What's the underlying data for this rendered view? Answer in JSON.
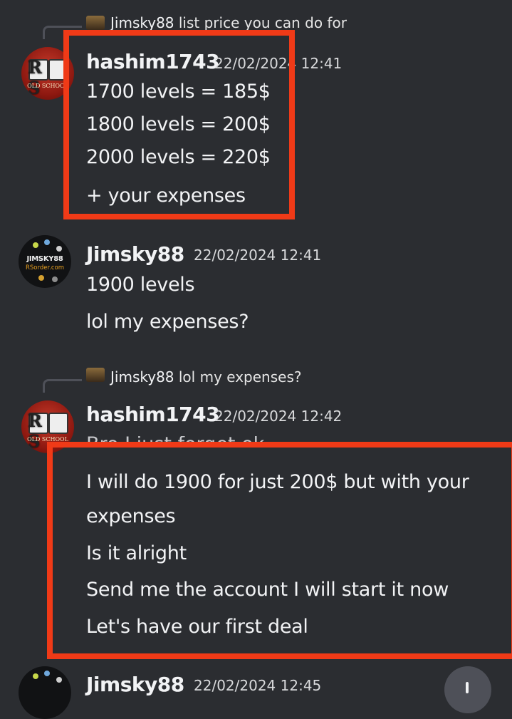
{
  "messages": [
    {
      "reply": {
        "author": "Jimsky88",
        "text": "list price you can do for"
      },
      "author": "hashim1743",
      "timestamp": "22/02/2024 12:41",
      "lines": [
        "1700 levels = 185$",
        "1800 levels = 200$",
        "2000 levels = 220$",
        "+ your expenses"
      ]
    },
    {
      "author": "Jimsky88",
      "timestamp": "22/02/2024 12:41",
      "lines": [
        "1900 levels",
        "lol my expenses?"
      ]
    },
    {
      "reply": {
        "author": "Jimsky88",
        "text": "lol my expenses?"
      },
      "author": "hashim1743",
      "timestamp": "22/02/2024 12:42",
      "lines": [
        "Bro I just forget ok",
        "I will do 1900 for just 200$ but with your",
        "expenses",
        "Is it alright",
        "Send me the account I will start it now",
        "Let's have our first deal"
      ]
    },
    {
      "author": "Jimsky88",
      "timestamp": "22/02/2024 12:45"
    }
  ],
  "avatars": {
    "hashim": {
      "initials": "R S",
      "subtitle": "OLD SCHOOL"
    },
    "jimsky": {
      "title": "JIMSKY88",
      "subtitle": "RSorder.com"
    }
  },
  "colors": {
    "highlight": "#f03a17",
    "background": "#2b2d31"
  },
  "icons": {
    "scroll": "arrow-down-icon"
  }
}
